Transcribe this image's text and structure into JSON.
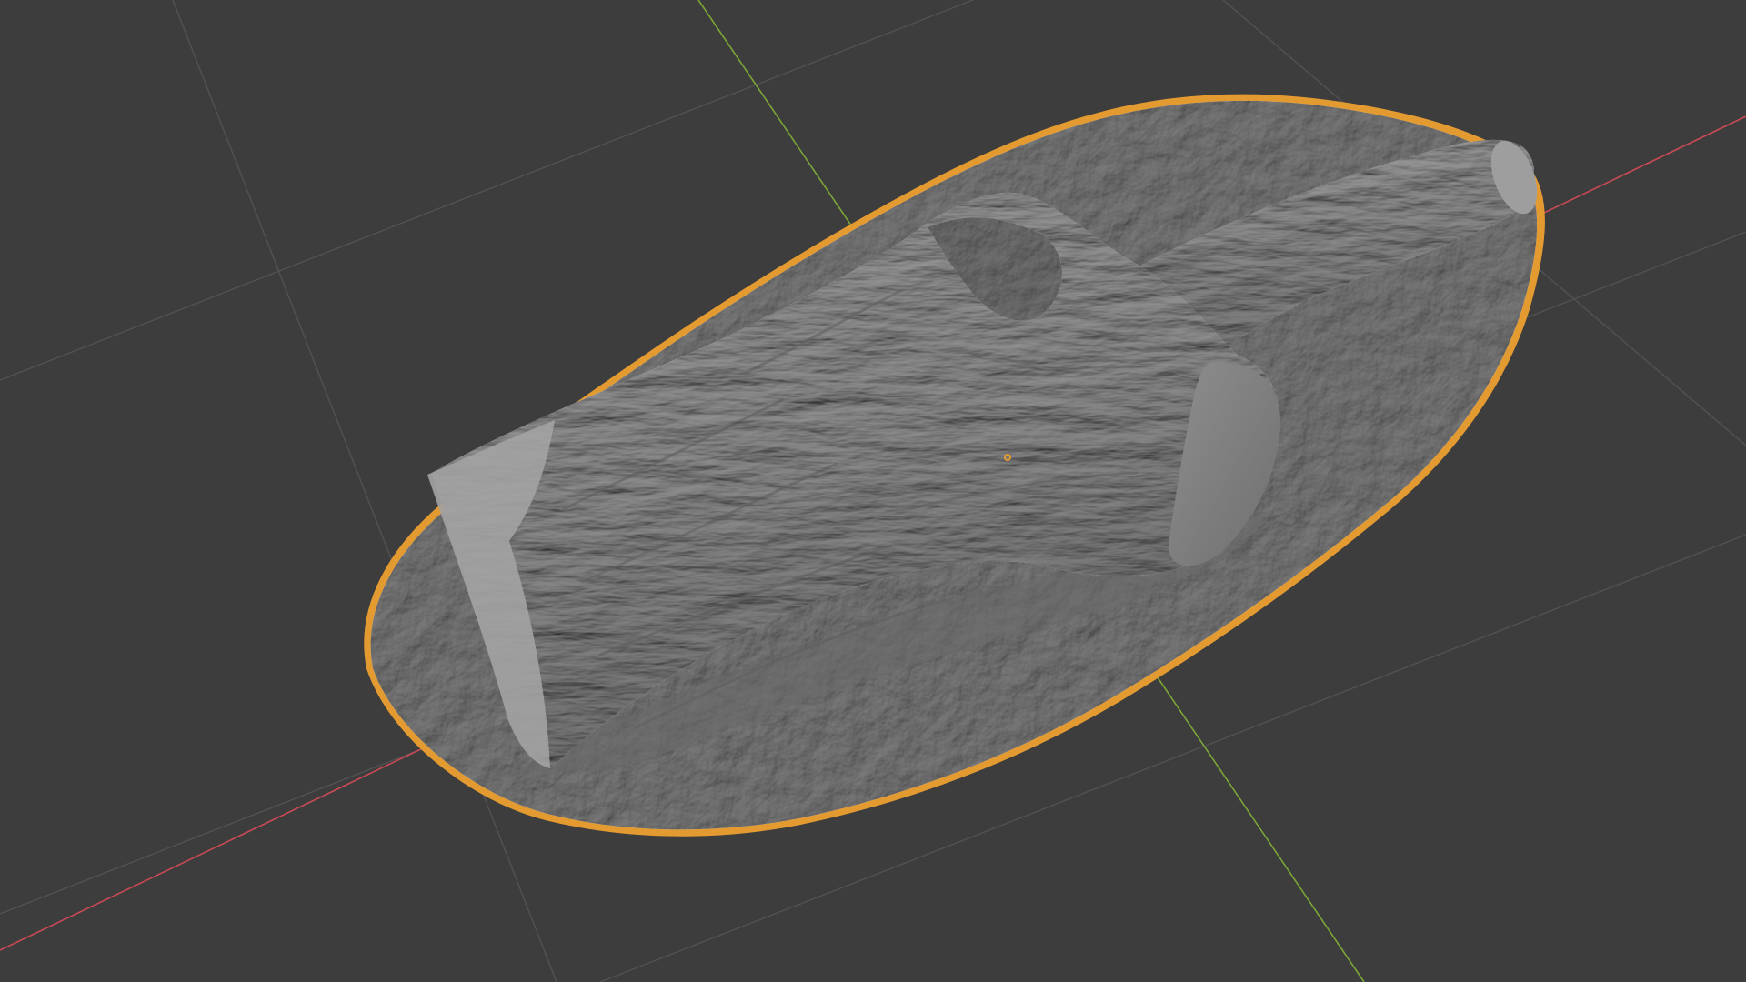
{
  "viewport": {
    "background_color": "#3d3d3d",
    "grid_color": "#525252",
    "x_axis_color": "#c94a55",
    "y_axis_color": "#7aa637",
    "selection_outline_color": "#e39b31",
    "origin_color": "#e39b31",
    "mesh_color": "#8d8d8d",
    "object": "sculpted-log-on-ground-mesh",
    "selected": true
  }
}
